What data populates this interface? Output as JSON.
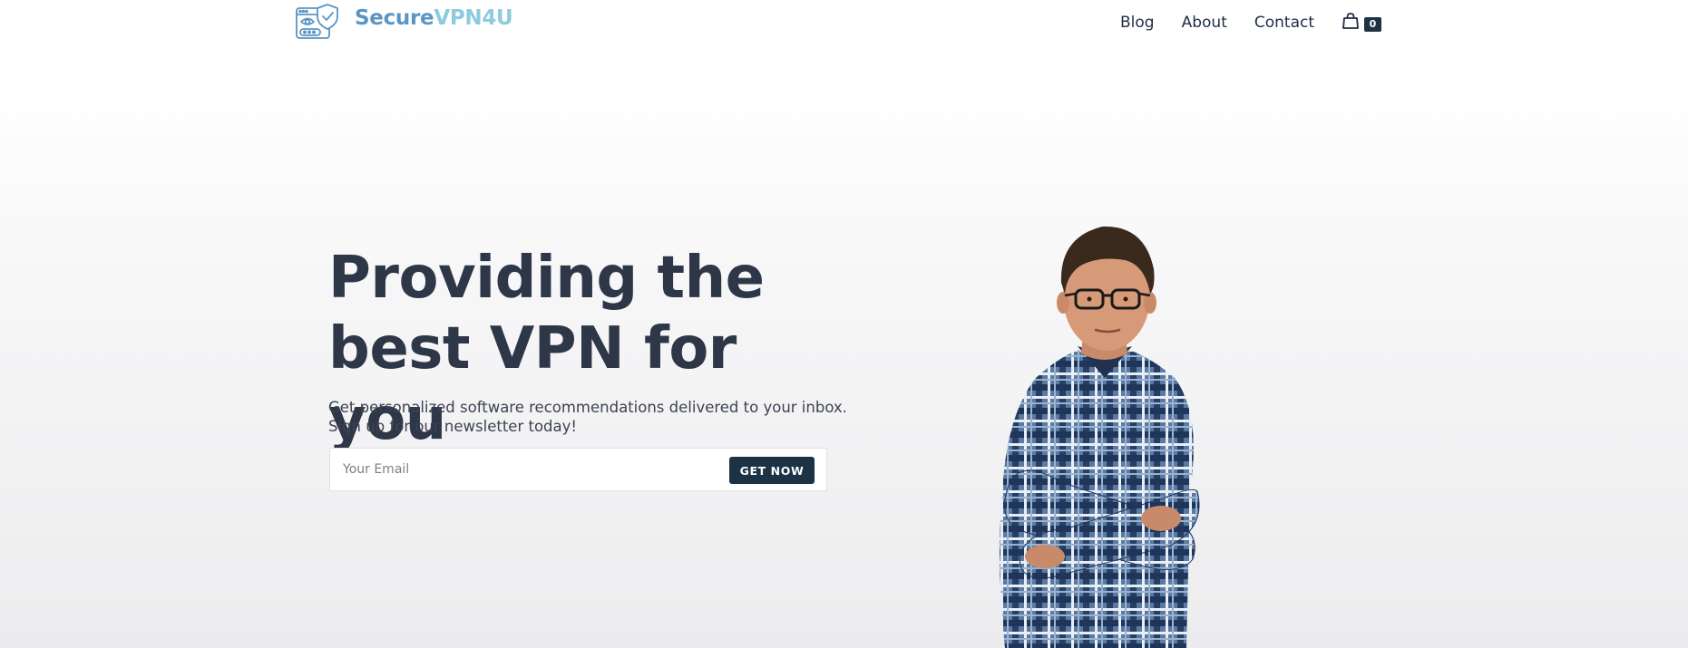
{
  "brand": {
    "name_part1": "Secure",
    "name_part2": "VPN4U",
    "colors": {
      "primary": "#5b95c4",
      "secondary": "#8ccbe0"
    },
    "logo_icon": "browser-shield-icon"
  },
  "nav": {
    "items": [
      {
        "label": "Blog"
      },
      {
        "label": "About"
      },
      {
        "label": "Contact"
      }
    ],
    "cart": {
      "icon": "shopping-bag-icon",
      "count": "0"
    }
  },
  "hero": {
    "title_line1": "Providing the",
    "title_line2": "best VPN for you",
    "subtitle_line1": "Get personalized software recommendations delivered to your inbox.",
    "subtitle_line2": "Sign up for our newsletter today!",
    "email_placeholder": "Your Email",
    "cta_label": "GET NOW",
    "image": "person-arms-crossed-image"
  },
  "colors": {
    "heading": "#2e3748",
    "nav_text": "#1f2d48",
    "button_bg": "#1b3344",
    "button_text": "#ffffff"
  }
}
